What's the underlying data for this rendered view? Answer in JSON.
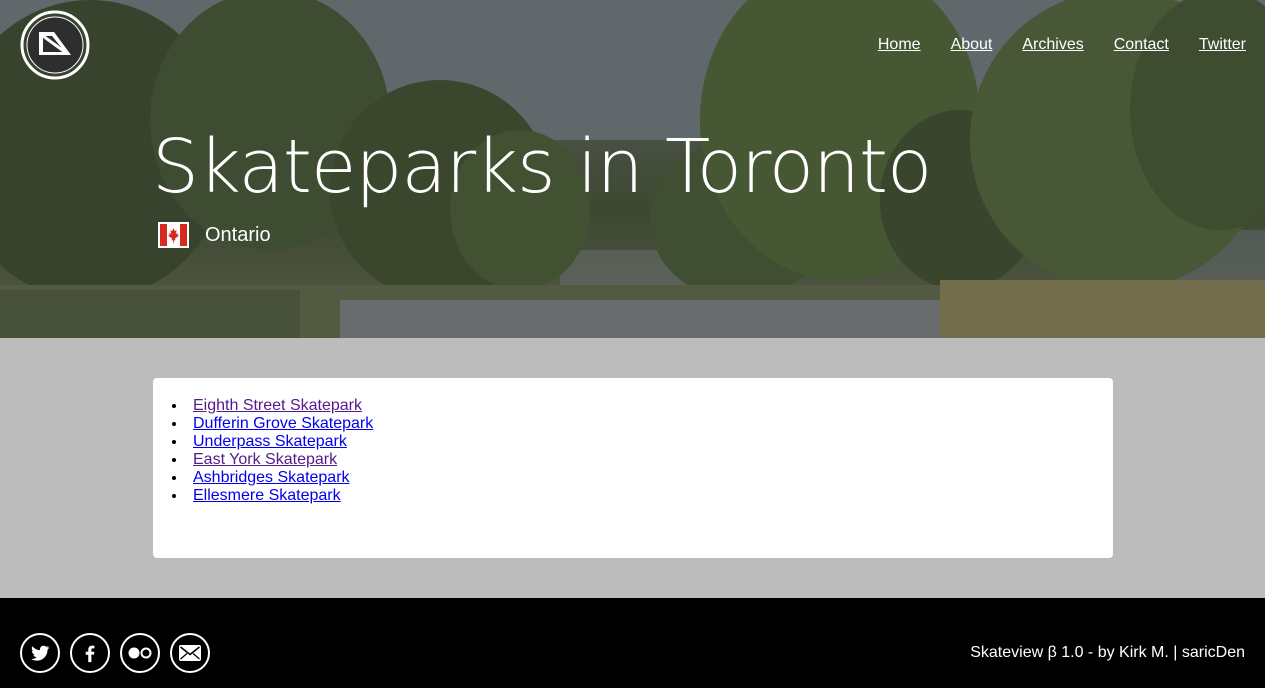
{
  "colors": {
    "accent_link": "#0000ee",
    "visited_link": "#551a8b",
    "footer_bg": "#000000",
    "page_bg": "#bcbcbc",
    "card_bg": "#ffffff",
    "flag_red": "#d52b1e"
  },
  "header": {
    "logo_icon": "skate-ramp-logo-icon",
    "nav": [
      {
        "label": "Home"
      },
      {
        "label": "About"
      },
      {
        "label": "Archives"
      },
      {
        "label": "Contact"
      },
      {
        "label": "Twitter"
      }
    ]
  },
  "hero": {
    "title": "Skateparks in Toronto",
    "flag_icon": "canada-flag-icon",
    "region": "Ontario"
  },
  "parks": [
    {
      "label": "Eighth Street Skatepark",
      "visited": true
    },
    {
      "label": "Dufferin Grove Skatepark",
      "visited": false
    },
    {
      "label": "Underpass Skatepark",
      "visited": false
    },
    {
      "label": "East York Skatepark",
      "visited": true
    },
    {
      "label": "Ashbridges Skatepark",
      "visited": false
    },
    {
      "label": "Ellesmere Skatepark",
      "visited": false
    }
  ],
  "footer": {
    "social": [
      {
        "icon": "twitter-icon"
      },
      {
        "icon": "facebook-icon"
      },
      {
        "icon": "flickr-icon"
      },
      {
        "icon": "email-icon"
      }
    ],
    "credit": "Skateview β 1.0 - by Kirk M. | saricDen"
  }
}
